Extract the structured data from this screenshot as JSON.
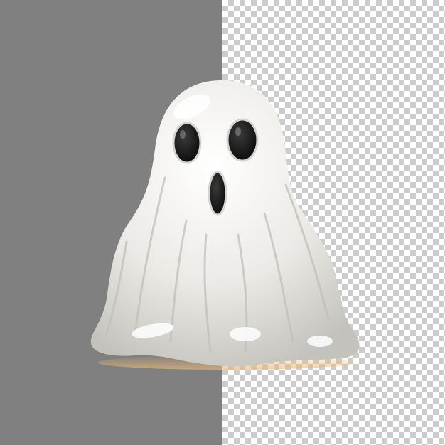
{
  "image": {
    "subject": "ghost-figure",
    "background": {
      "left_color": "#808080",
      "checker_light": "#ffffff",
      "checker_dark": "#cccccc"
    },
    "ghost_colors": {
      "body": "#eceae6",
      "shadow": "#c9c7c2",
      "highlight": "#ffffff",
      "eyes": "#111111",
      "base_glow": "#e8b877"
    }
  }
}
